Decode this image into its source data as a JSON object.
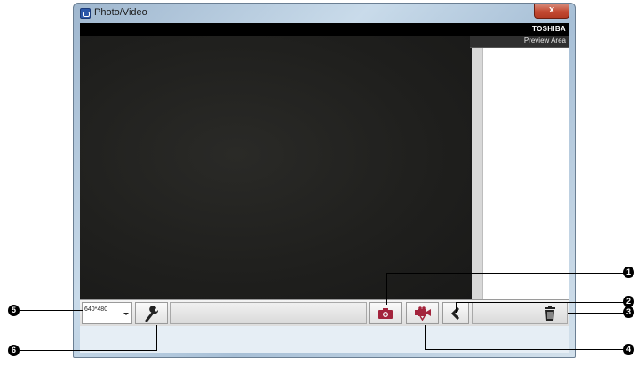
{
  "window": {
    "title": "Photo/Video",
    "close_glyph": "x"
  },
  "brand": "TOSHIBA",
  "preview": {
    "label": "Preview Area"
  },
  "toolbar": {
    "resolution": "640*480",
    "buttons": [
      "settings-icon",
      "camera-icon",
      "video-camera-icon",
      "chevron-left-icon",
      "trash-icon"
    ],
    "accent_color": "#a3243c"
  },
  "callouts": [
    "1",
    "2",
    "3",
    "4",
    "5",
    "6"
  ]
}
